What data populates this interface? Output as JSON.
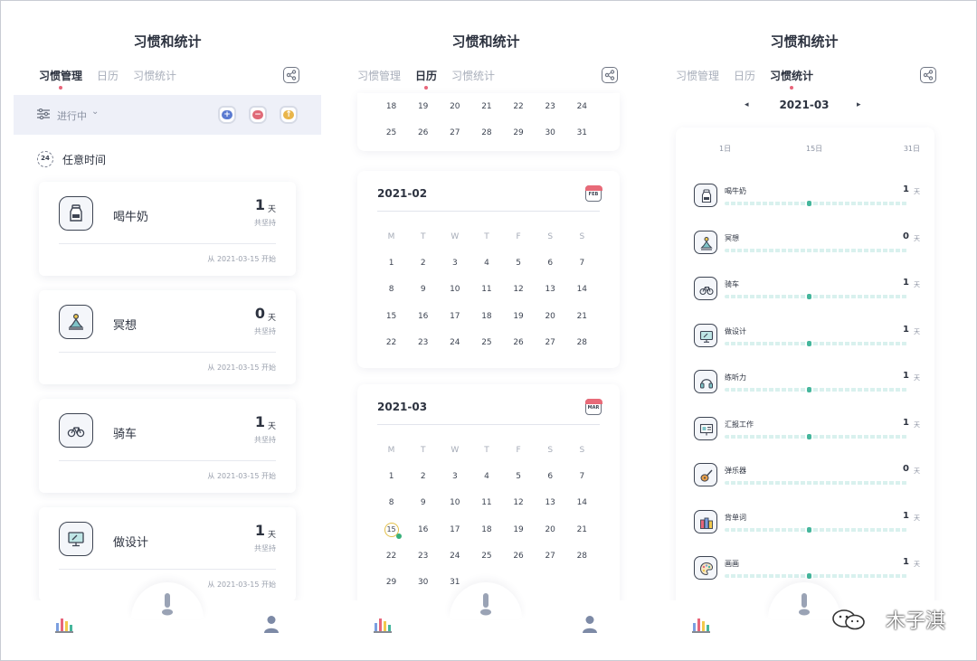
{
  "common": {
    "title": "习惯和统计",
    "tabs": [
      "习惯管理",
      "日历",
      "习惯统计"
    ]
  },
  "screen1": {
    "active_tab": 0,
    "filter_label": "进行中",
    "section_label": "任意时间",
    "section_icon_text": "24",
    "jar_buttons": [
      "+",
      "−",
      "↑"
    ],
    "habits": [
      {
        "name": "喝牛奶",
        "count": "1",
        "unit": "天",
        "sub": "共坚持",
        "start": "从 2021-03-15 开始",
        "icon": "milk-bottle-icon"
      },
      {
        "name": "冥想",
        "count": "0",
        "unit": "天",
        "sub": "共坚持",
        "start": "从 2021-03-15 开始",
        "icon": "meditation-icon"
      },
      {
        "name": "骑车",
        "count": "1",
        "unit": "天",
        "sub": "共坚持",
        "start": "从 2021-03-15 开始",
        "icon": "bicycle-icon"
      },
      {
        "name": "做设计",
        "count": "1",
        "unit": "天",
        "sub": "共坚持",
        "start": "从 2021-03-15 开始",
        "icon": "monitor-design-icon"
      }
    ]
  },
  "screen2": {
    "active_tab": 1,
    "partial_month": {
      "rows": [
        [
          "18",
          "19",
          "20",
          "21",
          "22",
          "23",
          "24"
        ],
        [
          "25",
          "26",
          "27",
          "28",
          "29",
          "30",
          "31"
        ]
      ]
    },
    "months": [
      {
        "label": "2021-02",
        "icon_text": "FEB",
        "dow": [
          "M",
          "T",
          "W",
          "T",
          "F",
          "S",
          "S"
        ],
        "rows": [
          [
            "1",
            "2",
            "3",
            "4",
            "5",
            "6",
            "7"
          ],
          [
            "8",
            "9",
            "10",
            "11",
            "12",
            "13",
            "14"
          ],
          [
            "15",
            "16",
            "17",
            "18",
            "19",
            "20",
            "21"
          ],
          [
            "22",
            "23",
            "24",
            "25",
            "26",
            "27",
            "28"
          ]
        ]
      },
      {
        "label": "2021-03",
        "icon_text": "MAR",
        "dow": [
          "M",
          "T",
          "W",
          "T",
          "F",
          "S",
          "S"
        ],
        "today": "15",
        "rows": [
          [
            "1",
            "2",
            "3",
            "4",
            "5",
            "6",
            "7"
          ],
          [
            "8",
            "9",
            "10",
            "11",
            "12",
            "13",
            "14"
          ],
          [
            "15",
            "16",
            "17",
            "18",
            "19",
            "20",
            "21"
          ],
          [
            "22",
            "23",
            "24",
            "25",
            "26",
            "27",
            "28"
          ],
          [
            "29",
            "30",
            "31",
            "",
            "",
            "",
            ""
          ]
        ]
      }
    ]
  },
  "screen3": {
    "active_tab": 2,
    "month": "2021-03",
    "prev_arrow": "◂",
    "next_arrow": "▸",
    "ticks": [
      "1日",
      "15日",
      "31日"
    ],
    "stats": [
      {
        "name": "喝牛奶",
        "count": "1",
        "unit": "天",
        "icon": "milk-bottle-icon",
        "dot": 0.45
      },
      {
        "name": "冥想",
        "count": "0",
        "unit": "天",
        "icon": "meditation-icon",
        "dot": null
      },
      {
        "name": "骑车",
        "count": "1",
        "unit": "天",
        "icon": "bicycle-icon",
        "dot": 0.45
      },
      {
        "name": "做设计",
        "count": "1",
        "unit": "天",
        "icon": "monitor-design-icon",
        "dot": 0.45
      },
      {
        "name": "练听力",
        "count": "1",
        "unit": "天",
        "icon": "headphones-icon",
        "dot": 0.45
      },
      {
        "name": "汇报工作",
        "count": "1",
        "unit": "天",
        "icon": "presentation-icon",
        "dot": 0.45
      },
      {
        "name": "弹乐器",
        "count": "0",
        "unit": "天",
        "icon": "guitar-icon",
        "dot": null
      },
      {
        "name": "背单词",
        "count": "1",
        "unit": "天",
        "icon": "books-icon",
        "dot": 0.45
      },
      {
        "name": "画画",
        "count": "1",
        "unit": "天",
        "icon": "palette-icon",
        "dot": 0.45
      }
    ]
  },
  "watermark": "木子淇",
  "colors": {
    "accent_pink": "#e8657a",
    "progress_teal": "#45b69c",
    "progress_track": "#d9f1ee",
    "filter_bg": "#eef0f8"
  }
}
